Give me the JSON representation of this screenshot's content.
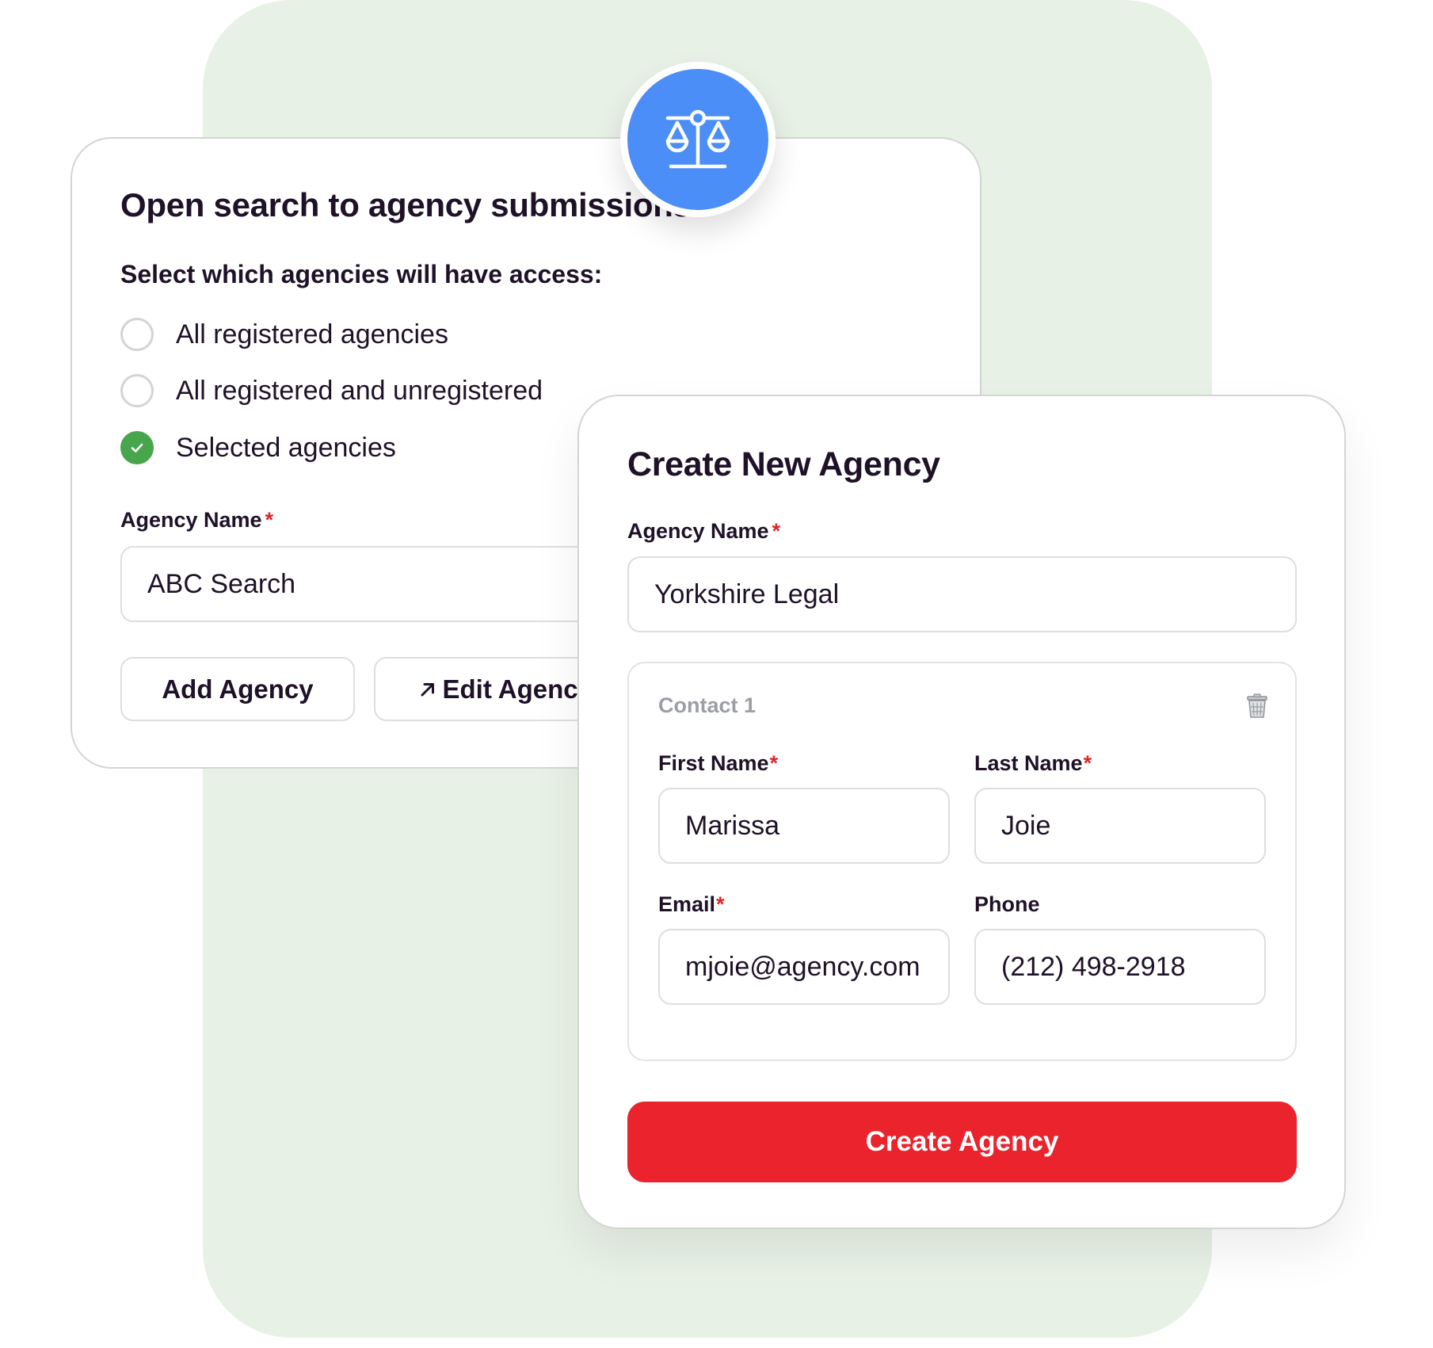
{
  "access_card": {
    "title": "Open search to agency submissions?",
    "subtitle": "Select which agencies will have access:",
    "options": [
      {
        "label": "All registered agencies",
        "selected": false
      },
      {
        "label": "All registered and unregistered",
        "selected": false
      },
      {
        "label": "Selected agencies",
        "selected": true
      }
    ],
    "agency_name_label": "Agency Name",
    "required_mark": "*",
    "agency_name_value": "ABC Search",
    "add_agency_label": "Add Agency",
    "edit_agency_label": "Edit Agencies"
  },
  "badge": {
    "icon": "scales-icon",
    "color": "#4b8ef7"
  },
  "create_card": {
    "title": "Create New Agency",
    "agency_name_label": "Agency Name",
    "required_mark": "*",
    "agency_name_value": "Yorkshire Legal",
    "contact": {
      "label": "Contact 1",
      "delete_icon": "trash-icon",
      "first_name_label": "First Name",
      "first_name_value": "Marissa",
      "last_name_label": "Last Name",
      "last_name_value": "Joie",
      "email_label": "Email",
      "email_value": "mjoie@agency.com",
      "phone_label": "Phone",
      "phone_value": "(212) 498-2918"
    },
    "submit_label": "Create Agency"
  },
  "colors": {
    "background_shape": "#e8f1e6",
    "accent_blue": "#4b8ef7",
    "success_green": "#47a64b",
    "primary_red": "#ea232d",
    "required_red": "#e0232c",
    "text_dark": "#1e1128"
  }
}
